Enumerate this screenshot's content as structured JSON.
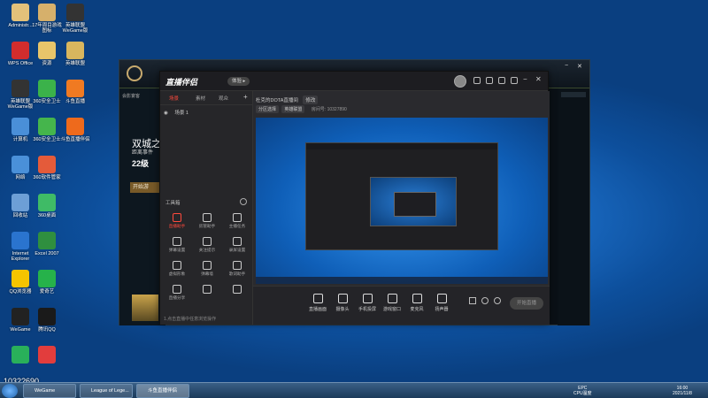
{
  "desktop": {
    "icons": [
      {
        "label": "Administr...",
        "color": "#e3c17a"
      },
      {
        "label": "17年周目游戏图标",
        "color": "#d6b06b"
      },
      {
        "label": "英雄联盟 WeGame版",
        "color": "#333333"
      },
      {
        "label": "WPS Office",
        "color": "#d22d2d"
      },
      {
        "label": "资源",
        "color": "#e8c56a"
      },
      {
        "label": "英雄联盟",
        "color": "#d8b65e"
      },
      {
        "label": "英雄联盟 WeGame版",
        "color": "#333333"
      },
      {
        "label": "360安全卫士",
        "color": "#3bb24a"
      },
      {
        "label": "斗鱼直播",
        "color": "#f07a22"
      },
      {
        "label": "计算机",
        "color": "#4a8fd8"
      },
      {
        "label": "360安全卫士",
        "color": "#45b54c"
      },
      {
        "label": "斗鱼直播伴侣",
        "color": "#ee6a1c"
      },
      {
        "label": "网络",
        "color": "#4a90d9"
      },
      {
        "label": "360软件管家",
        "color": "#e45b3a"
      },
      {
        "label": "回收站",
        "color": "#6d9fd6"
      },
      {
        "label": "360桌面",
        "color": "#3fbb66"
      },
      {
        "label": "Internet Explorer",
        "color": "#2a74cf"
      },
      {
        "label": "Excel 2007",
        "color": "#2f8f3f"
      },
      {
        "label": "QQ浏览器",
        "color": "#f5c400"
      },
      {
        "label": "爱奇艺",
        "color": "#26b24a"
      },
      {
        "label": "WeGame",
        "color": "#222222"
      },
      {
        "label": "腾讯QQ",
        "color": "#1a1a1a"
      },
      {
        "label": "",
        "color": "#29b05a"
      },
      {
        "label": "",
        "color": "#e23d3d"
      }
    ],
    "watermark": "1032?690"
  },
  "lol": {
    "text1": "双城之",
    "text2": "距离事件",
    "text3": "22级",
    "button": "开始游",
    "nav": "会影宴客"
  },
  "app": {
    "logo": "直播伴侣",
    "badge": "体验 ▸",
    "tabs": [
      "场景",
      "素材",
      "观众"
    ],
    "scene": "场景 1",
    "toolbox_title": "工具箱",
    "tools": [
      {
        "label": "直播助手"
      },
      {
        "label": "房管助手"
      },
      {
        "label": "主播任务"
      },
      {
        "label": "弹幕设置"
      },
      {
        "label": "关注提示"
      },
      {
        "label": "录屏设置"
      },
      {
        "label": "虚拟形象"
      },
      {
        "label": "弹幕墙"
      },
      {
        "label": "歌词助手"
      },
      {
        "label": "直播分享"
      },
      {
        "label": ""
      },
      {
        "label": ""
      }
    ],
    "prompt": "1.点击直播中任意浏览操作",
    "title": "杜克的DOTA直播间",
    "title_tag": "修改",
    "room": "房间号: 10327890",
    "chips": [
      "分区选择",
      "英雄联盟"
    ],
    "controls": [
      {
        "label": "直播画面"
      },
      {
        "label": "摄像头"
      },
      {
        "label": "手机投屏"
      },
      {
        "label": "游戏窗口"
      },
      {
        "label": "麦克风"
      },
      {
        "label": "扬声器"
      }
    ],
    "golive": "开始直播"
  },
  "taskbar": {
    "items": [
      {
        "label": "WeGame"
      },
      {
        "label": "League of Lege..."
      },
      {
        "label": "斗鱼直播伴侣"
      }
    ],
    "tray_cpu": "EPC\nCPU温度",
    "time": "16:00",
    "date": "2021/11/8"
  }
}
